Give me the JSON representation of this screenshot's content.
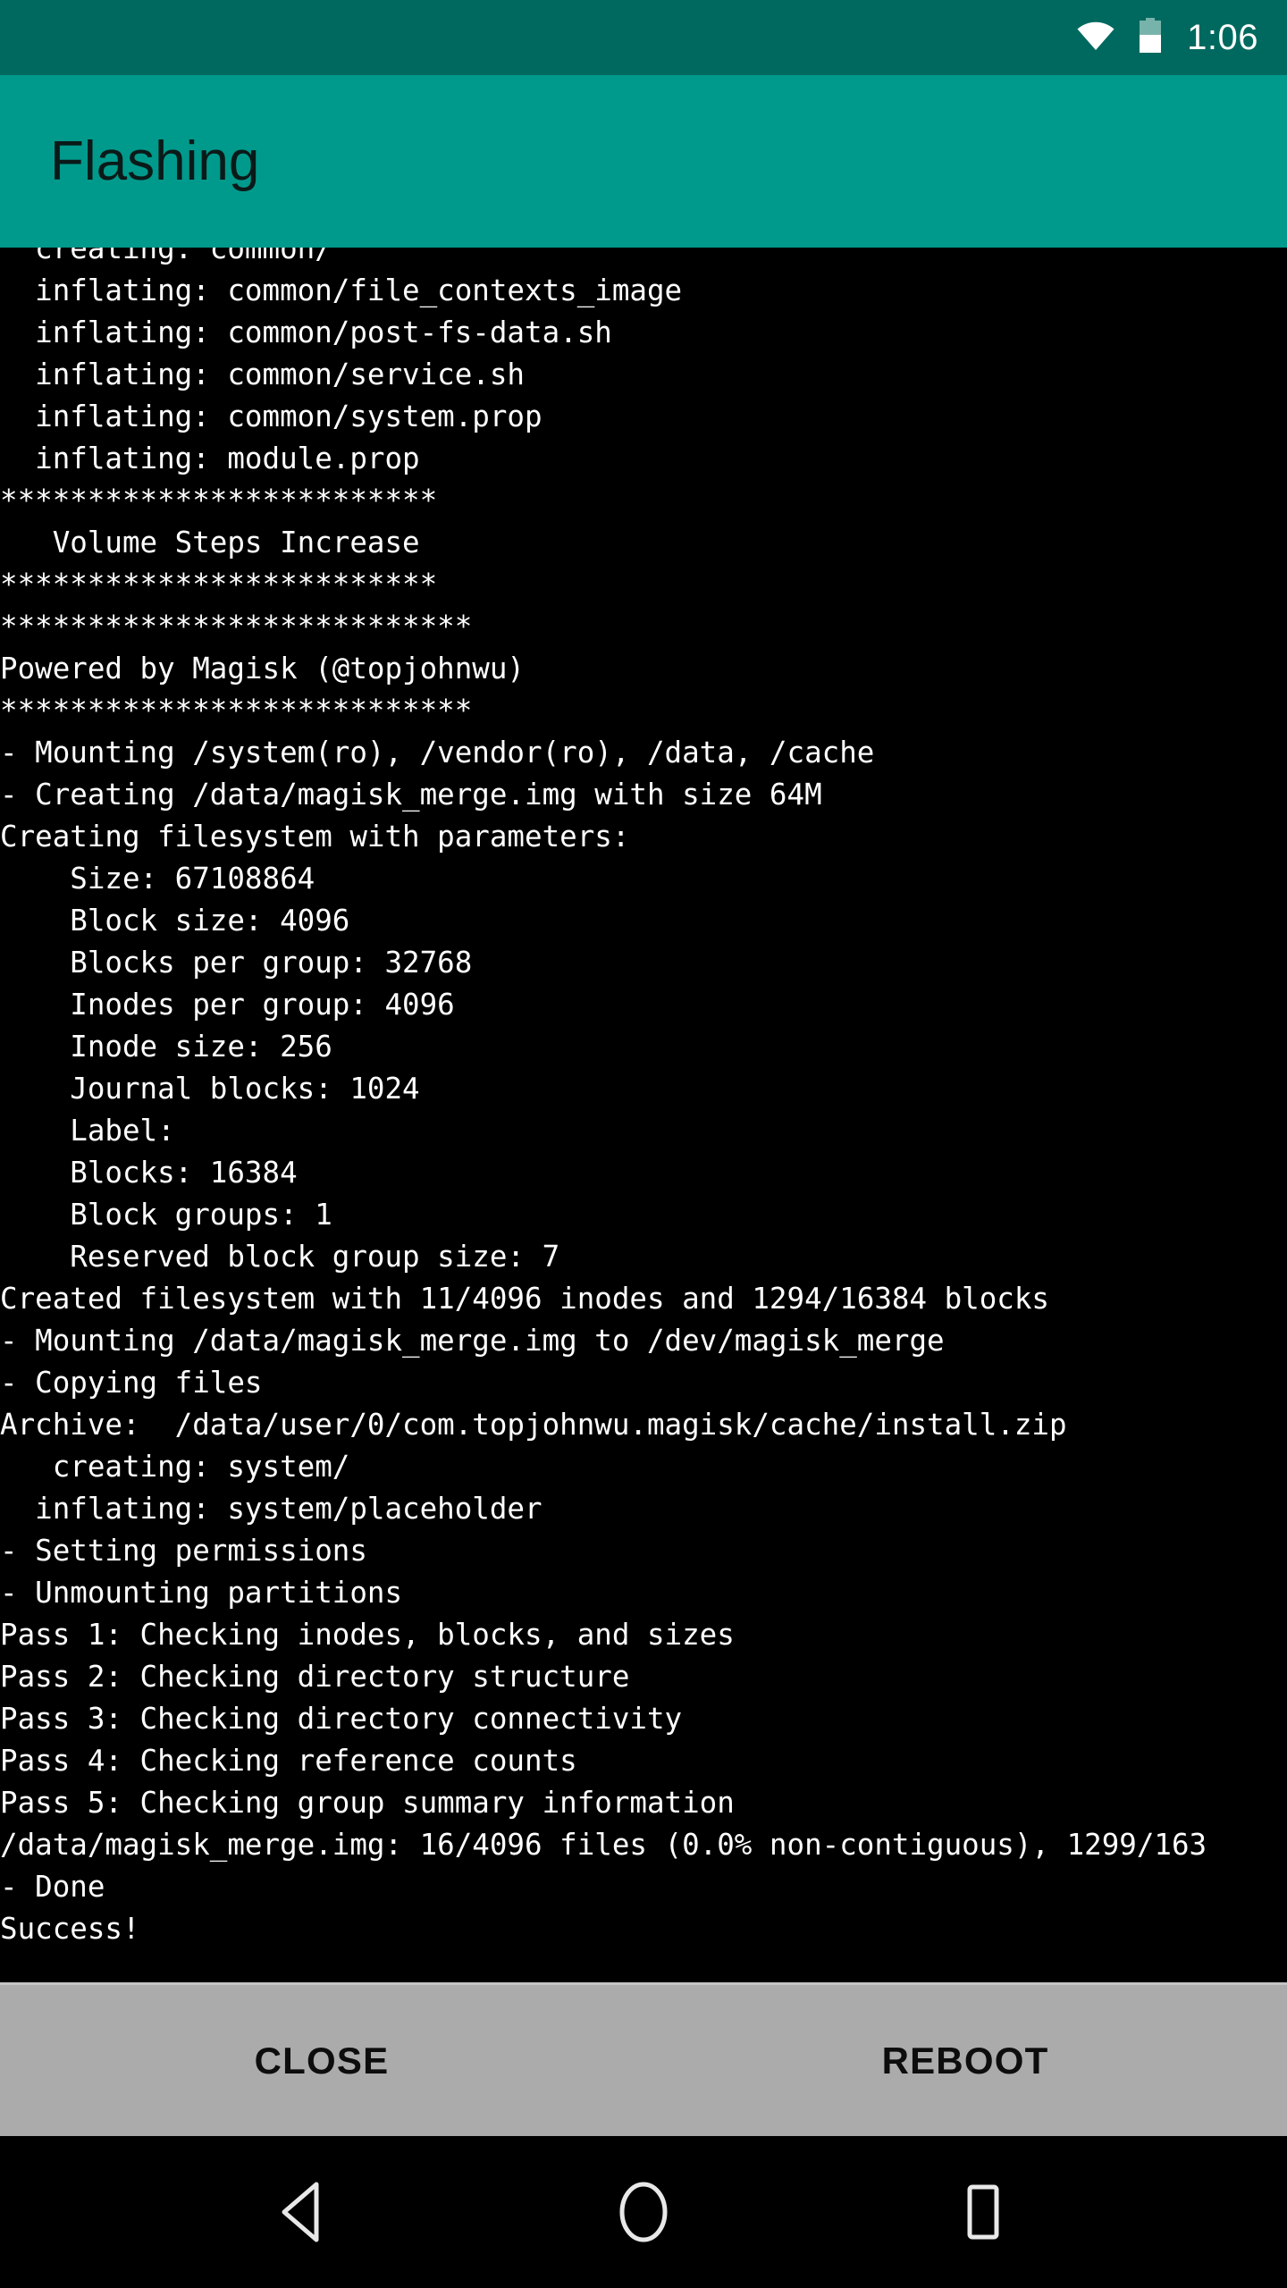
{
  "status_bar": {
    "wifi_icon": "wifi-full-icon",
    "battery_icon": "battery-half-icon",
    "clock": "1:06",
    "background_color": "#00695f",
    "foreground_color": "#ffffff"
  },
  "app_bar": {
    "title": "Flashing",
    "background_color": "#009a8c",
    "title_color": "#0a1a18"
  },
  "terminal": {
    "background_color": "#000000",
    "text_color": "#ffffff",
    "first_line_clipped": true,
    "lines": [
      "  creating: common/",
      "  inflating: common/file_contexts_image",
      "  inflating: common/post-fs-data.sh",
      "  inflating: common/service.sh",
      "  inflating: common/system.prop",
      "  inflating: module.prop",
      "*************************",
      "   Volume Steps Increase",
      "*************************",
      "***************************",
      "Powered by Magisk (@topjohnwu)",
      "***************************",
      "- Mounting /system(ro), /vendor(ro), /data, /cache",
      "- Creating /data/magisk_merge.img with size 64M",
      "Creating filesystem with parameters:",
      "    Size: 67108864",
      "    Block size: 4096",
      "    Blocks per group: 32768",
      "    Inodes per group: 4096",
      "    Inode size: 256",
      "    Journal blocks: 1024",
      "    Label:",
      "    Blocks: 16384",
      "    Block groups: 1",
      "    Reserved block group size: 7",
      "Created filesystem with 11/4096 inodes and 1294/16384 blocks",
      "- Mounting /data/magisk_merge.img to /dev/magisk_merge",
      "- Copying files",
      "Archive:  /data/user/0/com.topjohnwu.magisk/cache/install.zip",
      "   creating: system/",
      "  inflating: system/placeholder",
      "- Setting permissions",
      "- Unmounting partitions",
      "Pass 1: Checking inodes, blocks, and sizes",
      "Pass 2: Checking directory structure",
      "Pass 3: Checking directory connectivity",
      "Pass 4: Checking reference counts",
      "Pass 5: Checking group summary information",
      "/data/magisk_merge.img: 16/4096 files (0.0% non-contiguous), 1299/163",
      "- Done",
      "Success!"
    ]
  },
  "button_bar": {
    "background_color": "#ababab",
    "close_label": "CLOSE",
    "reboot_label": "REBOOT"
  },
  "nav_bar": {
    "background_color": "#000000",
    "back_icon": "back-triangle-icon",
    "home_icon": "home-circle-icon",
    "recents_icon": "recents-square-icon"
  }
}
